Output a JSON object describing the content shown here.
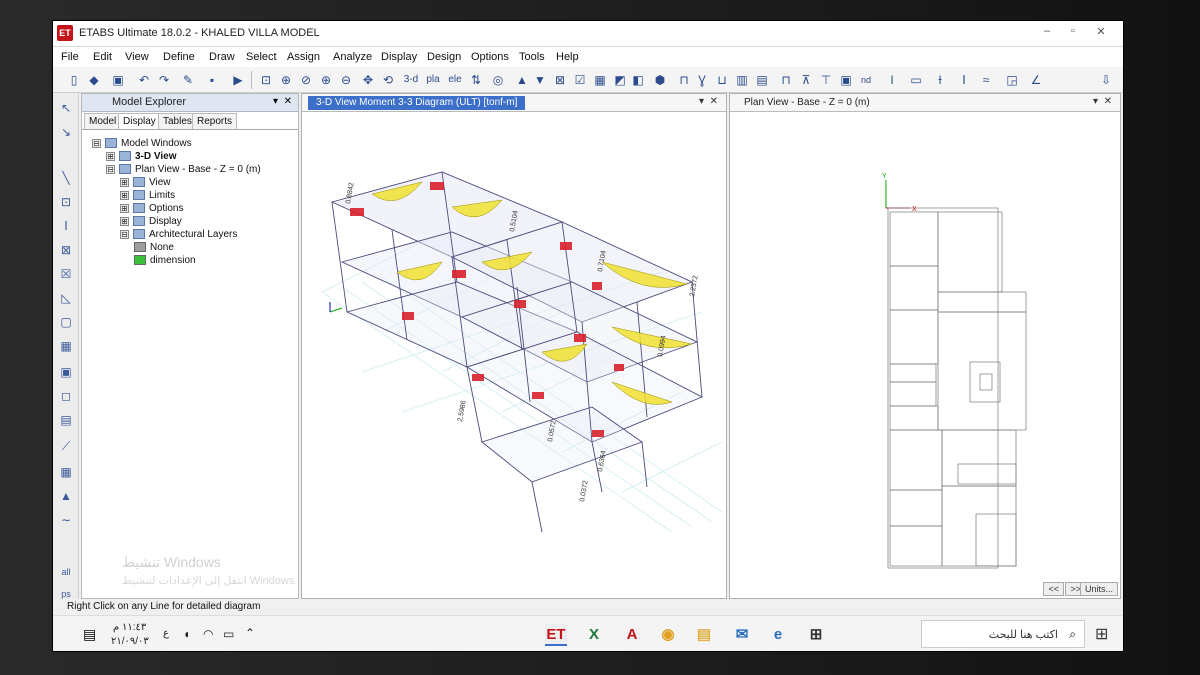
{
  "window": {
    "app_icon": "ET",
    "title": "ETABS Ultimate 18.0.2 - KHALED VILLA MODEL",
    "controls": [
      "–",
      "▫",
      "✕"
    ]
  },
  "menu": [
    "File",
    "Edit",
    "View",
    "Define",
    "Draw",
    "Select",
    "Assign",
    "Analyze",
    "Display",
    "Design",
    "Options",
    "Tools",
    "Help"
  ],
  "toolbar": {
    "labels": [
      "3-d",
      "pla",
      "ele",
      "nd"
    ],
    "download_icon": "download-icon"
  },
  "explorer": {
    "title": "Model Explorer",
    "tabs": [
      "Model",
      "Display",
      "Tables",
      "Reports"
    ],
    "active_tab": "Display",
    "tree": [
      {
        "label": "Model Windows",
        "level": 0,
        "box": "⊟"
      },
      {
        "label": "3-D View",
        "level": 1,
        "box": "⊞",
        "bold": true
      },
      {
        "label": "Plan View - Base - Z = 0 (m)",
        "level": 1,
        "box": "⊟"
      },
      {
        "label": "View",
        "level": 2,
        "box": "⊞"
      },
      {
        "label": "Limits",
        "level": 2,
        "box": "⊞"
      },
      {
        "label": "Options",
        "level": 2,
        "box": "⊞"
      },
      {
        "label": "Display",
        "level": 2,
        "box": "⊞"
      },
      {
        "label": "Architectural Layers",
        "level": 2,
        "box": "⊟"
      },
      {
        "label": "None",
        "level": 3,
        "swatch": "#9e9e9e"
      },
      {
        "label": "dimension",
        "level": 3,
        "swatch": "#3cc13c"
      }
    ],
    "watermark": "تنشيط Windows",
    "watermark_sub": "انتقل إلى الإعدادات لتنشيط Windows."
  },
  "view3d": {
    "title": "3-D View   Moment 3-3 Diagram   (ULT)  [tonf-m]",
    "controls": [
      "▾",
      "✕"
    ],
    "moment_labels": [
      "0.7104",
      "0.0572",
      "0.0372",
      "0.6364",
      "2.5986",
      "0.5104",
      "0.0994",
      "2.2372",
      "0.8842"
    ],
    "colors": {
      "positive": "#f0e030",
      "negative": "#d8212b",
      "frame": "#4a4a7a",
      "grid": "#bfe7f0"
    }
  },
  "plan": {
    "title": "Plan View - Base - Z = 0 (m)",
    "controls": [
      "▾",
      "✕"
    ],
    "axis_x": "X",
    "axis_y": "Y",
    "nav": [
      "<<",
      ">>",
      "Units..."
    ]
  },
  "status": {
    "text": "Right Click on any Line for detailed diagram"
  },
  "taskbar": {
    "time": "١١:٤٣ م",
    "date": "٢١/٠٩/٠٣",
    "lang": "ع",
    "search_placeholder": "اكتب هنا للبحث",
    "apps": [
      "ET",
      "X",
      "A",
      "◉",
      "▤",
      "✉",
      "e",
      "⊞"
    ]
  }
}
